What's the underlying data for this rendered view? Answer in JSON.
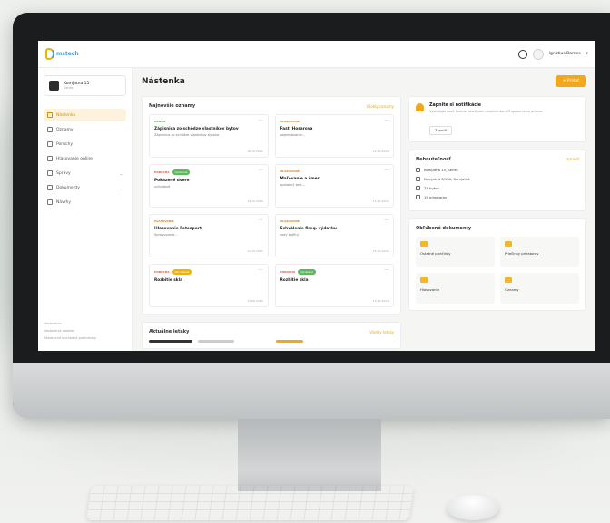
{
  "app": {
    "logo_text": "mstech"
  },
  "header": {
    "user_name": "Ignatius Barnes"
  },
  "sidebar": {
    "company": {
      "name": "Komjatna 15",
      "sub": "Senec"
    },
    "items": [
      {
        "label": "Nástenka",
        "icon": "home-icon",
        "active": true
      },
      {
        "label": "Oznamy",
        "icon": "megaphone-icon"
      },
      {
        "label": "Poruchy",
        "icon": "warning-icon"
      },
      {
        "label": "Hlasovanie online",
        "icon": "vote-icon"
      },
      {
        "label": "Správy",
        "icon": "chat-icon",
        "chevron": true
      },
      {
        "label": "Dokumenty",
        "icon": "document-icon",
        "chevron": true
      },
      {
        "label": "Návrhy",
        "icon": "lightbulb-icon"
      }
    ],
    "footer_links": [
      "Nastavenia",
      "Nastavenie cookies",
      "Všeobecné obchodné podmienky"
    ]
  },
  "main": {
    "title": "Nástenka",
    "add_button": "+ Pridať",
    "latest": {
      "title": "Najnovšie oznamy",
      "link": "Všetky oznamy",
      "cards": [
        {
          "tag": "OZNAM",
          "tag_color": "green",
          "pill": "",
          "title": "Zápisnica zo schôdze vlastníkov bytov",
          "sub": "Zápisnica zo schôdze vlastníkov bytova",
          "date": "16.10.2020"
        },
        {
          "tag": "HLASOVANIE",
          "tag_color": "orange",
          "pill": "",
          "title": "Fasti Hosarova",
          "sub": "pojednávanie...",
          "date": "15.10.2024"
        },
        {
          "tag": "PORUCHA",
          "tag_color": "red",
          "pill": "Vyriešené",
          "pill_color": "green",
          "title": "Pokazené dvere",
          "sub": "vchodové",
          "date": "14.10.2020"
        },
        {
          "tag": "HLASOVANIE",
          "tag_color": "orange",
          "pill": "",
          "title": "Maľovanie a čmer",
          "sub": "spoločný text...",
          "date": "15.10.2024"
        },
        {
          "tag": "HLASOVANIE",
          "tag_color": "orange",
          "pill": "",
          "title": "Hlasovanie Fotoapart",
          "sub": "Spravovanie...",
          "date": "12.10.2020"
        },
        {
          "tag": "HLASOVANIE",
          "tag_color": "orange",
          "pill": "",
          "title": "Schválenie fireq. výdavku",
          "sub": "rody bojfluj",
          "date": "15.10.2024"
        },
        {
          "tag": "PORUCHA",
          "tag_color": "red",
          "pill": "Nie riešené",
          "pill_color": "yellow",
          "title": "Rozbitie skla",
          "sub": "",
          "date": "12.06.2020"
        },
        {
          "tag": "PORUCHA",
          "tag_color": "red",
          "pill": "Vyriešené",
          "pill_color": "green",
          "title": "Rozbitie skla",
          "sub": "",
          "date": "15.10.2024"
        }
      ]
    },
    "news": {
      "title": "Aktuálne letáky",
      "link": "Všetky letáky"
    }
  },
  "right": {
    "notice": {
      "title": "Zapnite si notifikácie",
      "text": "Vyskúšajte nové funkcie, ktoré vám umožnia doručiť upozornenia priamo.",
      "button": "Zapnúť"
    },
    "property": {
      "title": "Nehnuteľnosť",
      "link": "Upraviť",
      "rows": [
        {
          "icon": "building-icon",
          "text": "Komjatna 15, Senec"
        },
        {
          "icon": "pin-icon",
          "text": "Komjatná 3/15A, Komjatná"
        },
        {
          "icon": "list-icon",
          "text": "25 bytov"
        },
        {
          "icon": "calendar-icon",
          "text": "19 priestorov"
        }
      ]
    },
    "favorites": {
      "title": "Obľúbené dokumenty",
      "items": [
        "Ostatné priečinky",
        "Priečinky priestorov",
        "Hlasovanie",
        "Oznamy"
      ]
    }
  },
  "colors": {
    "accent": "#f2a81d",
    "link": "#e2a626",
    "green": "#5cb85c",
    "red": "#d9534f"
  }
}
